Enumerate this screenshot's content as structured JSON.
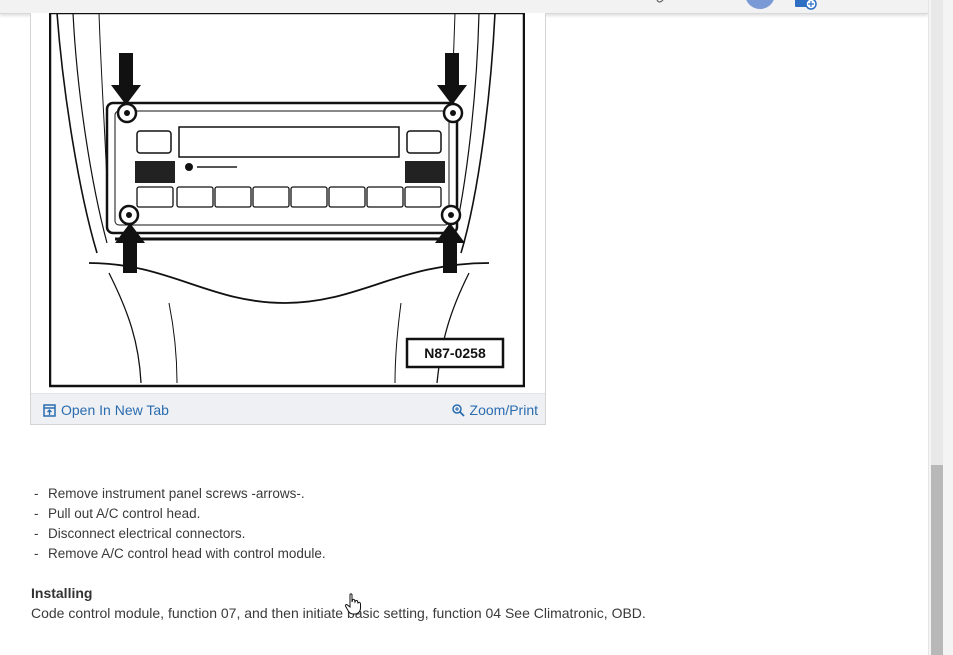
{
  "figure": {
    "callout_label": "N87-0258",
    "open_tab_label": "Open In New Tab",
    "zoom_label": "Zoom/Print"
  },
  "steps": [
    "Remove instrument panel screws -arrows-.",
    "Pull out A/C control head.",
    "Disconnect electrical connectors.",
    "Remove A/C control head with control module."
  ],
  "step_bullet": "-",
  "installing": {
    "heading": "Installing",
    "text": "Code control module, function 07, and then initiate basic setting, function 04 See Climatronic, OBD."
  },
  "colors": {
    "link": "#2a6cb0",
    "figure_bar": "#eef0f3",
    "scroll_thumb": "#b8b8b8"
  }
}
